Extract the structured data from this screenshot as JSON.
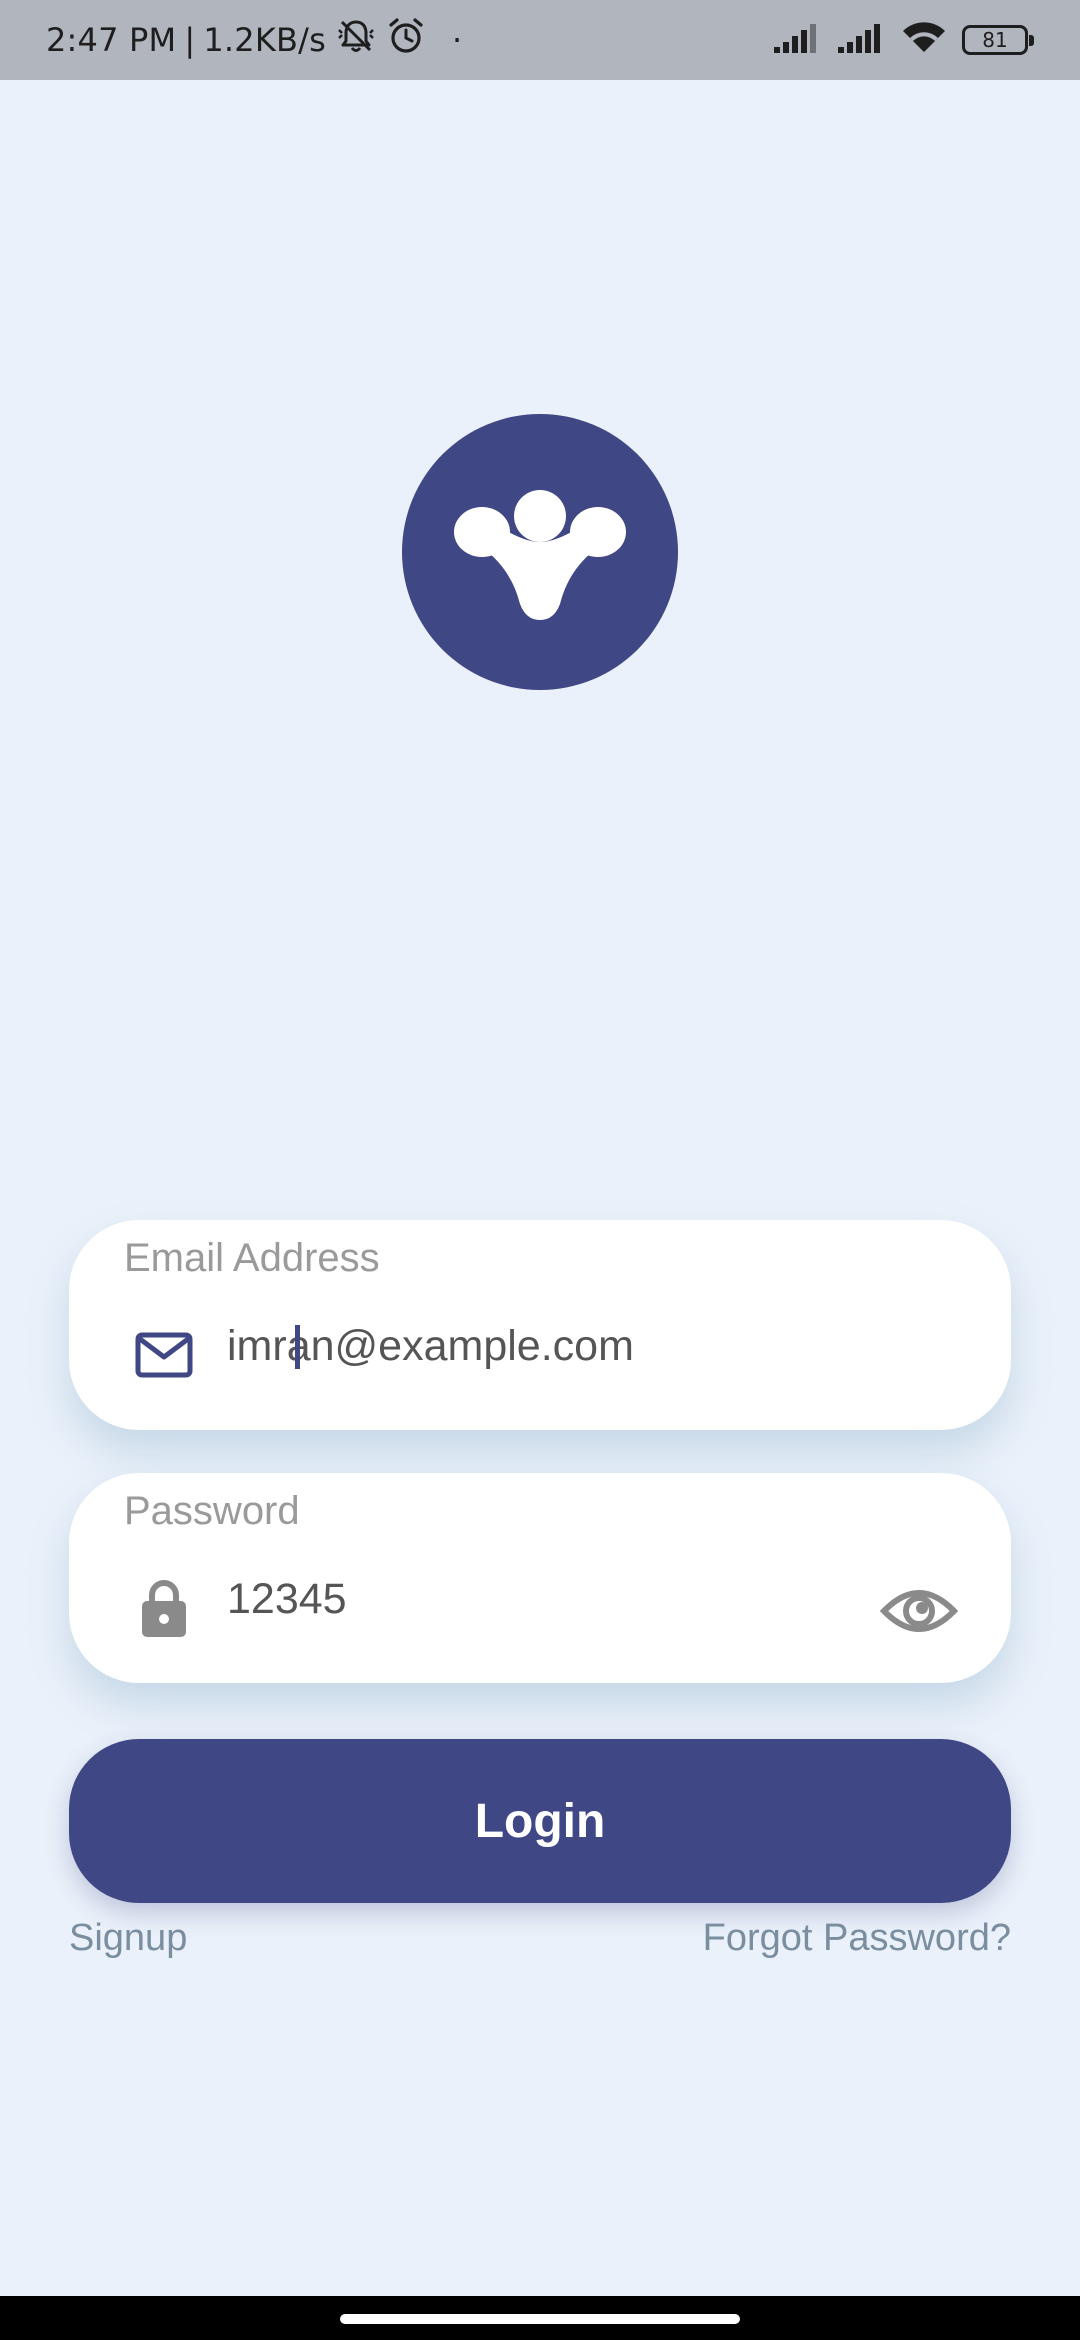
{
  "status_bar": {
    "time": "2:47 PM",
    "separator": "|",
    "speed": "1.2KB/s",
    "dot": "·",
    "battery": "81",
    "icons": [
      "bell-muted-icon",
      "alarm-icon",
      "signal-icon",
      "signal-icon",
      "wifi-icon",
      "battery-icon"
    ]
  },
  "logo": {
    "icon": "app-logo-icon",
    "color": "#3F4785"
  },
  "email": {
    "label": "Email Address",
    "value": "imran@example.com",
    "icon": "mail-icon"
  },
  "password": {
    "label": "Password",
    "value": "12345",
    "icon": "lock-icon",
    "toggle_icon": "eye-icon"
  },
  "login": {
    "label": "Login"
  },
  "links": {
    "signup": "Signup",
    "forgot": "Forgot Password?"
  },
  "colors": {
    "background": "#EAF1FA",
    "accent": "#3F4785",
    "status_bar": "#B0B5BE",
    "link": "#7A8EA0"
  }
}
